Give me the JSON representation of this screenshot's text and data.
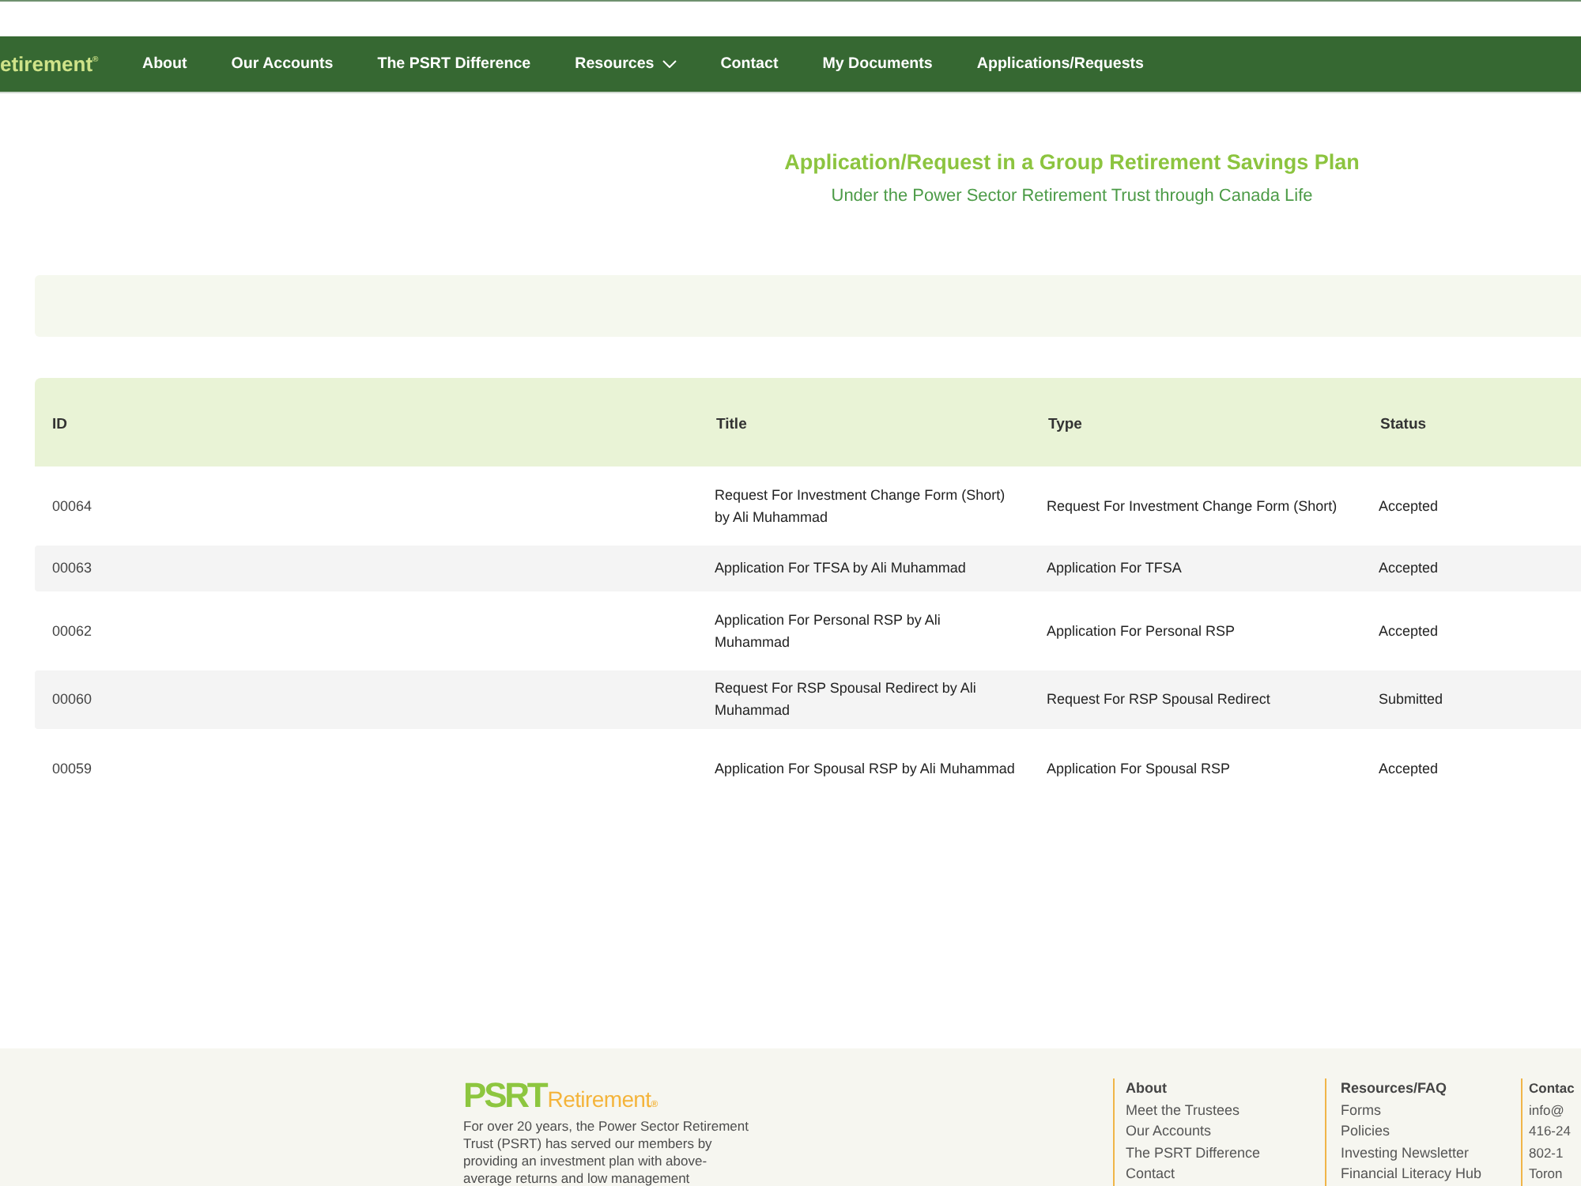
{
  "nav": {
    "logo": "etirement$^{®}$",
    "items": [
      {
        "label": "About",
        "kind": "link"
      },
      {
        "label": "Our Accounts",
        "kind": "link"
      },
      {
        "label": "The PSRT Difference",
        "kind": "link"
      },
      {
        "label": "Resources",
        "kind": "dropdown"
      },
      {
        "label": "Contact",
        "kind": "link"
      },
      {
        "label": "My Documents",
        "kind": "link"
      },
      {
        "label": "Applications/Requests",
        "kind": "link"
      }
    ]
  },
  "hero": {
    "title": "Application/Request in a Group Retirement Savings Plan",
    "subtitle": "Under the Power Sector Retirement Trust through Canada Life"
  },
  "table": {
    "columns": [
      "ID",
      "Title",
      "Type",
      "Status"
    ],
    "rows": [
      {
        "id": "00064",
        "title": "Request For Investment Change Form (Short) by Ali Muhammad",
        "type": "Request For Investment Change Form (Short)",
        "status": "Accepted"
      },
      {
        "id": "00063",
        "title": "Application For TFSA by Ali Muhammad",
        "type": "Application For TFSA",
        "status": "Accepted"
      },
      {
        "id": "00062",
        "title": "Application For Personal RSP by Ali Muhammad",
        "type": "Application For Personal RSP",
        "status": "Accepted"
      },
      {
        "id": "00060",
        "title": "Request For RSP Spousal Redirect by Ali Muhammad",
        "type": "Request For RSP Spousal Redirect",
        "status": "Submitted"
      },
      {
        "id": "00059",
        "title": "Application For Spousal RSP by Ali Muhammad",
        "type": "Application For Spousal RSP",
        "status": "Accepted"
      }
    ]
  },
  "footer": {
    "logo": {
      "mark": "PSRT",
      "word": "Retirement",
      "symbol": "®"
    },
    "description": "For over 20 years, the Power Sector Retirement Trust (PSRT) has served our members by providing an investment plan with above-average returns and low management",
    "columns": [
      {
        "heading": "About",
        "items": [
          "Meet the Trustees",
          "Our Accounts",
          "The PSRT Difference",
          "Contact"
        ]
      },
      {
        "heading": "Resources/FAQ",
        "items": [
          "Forms",
          "Policies",
          "Investing Newsletter",
          "Financial Literacy Hub"
        ]
      },
      {
        "heading": "Contac",
        "items": [
          "info@",
          "416-24",
          "802-1",
          "Toron"
        ]
      }
    ]
  }
}
